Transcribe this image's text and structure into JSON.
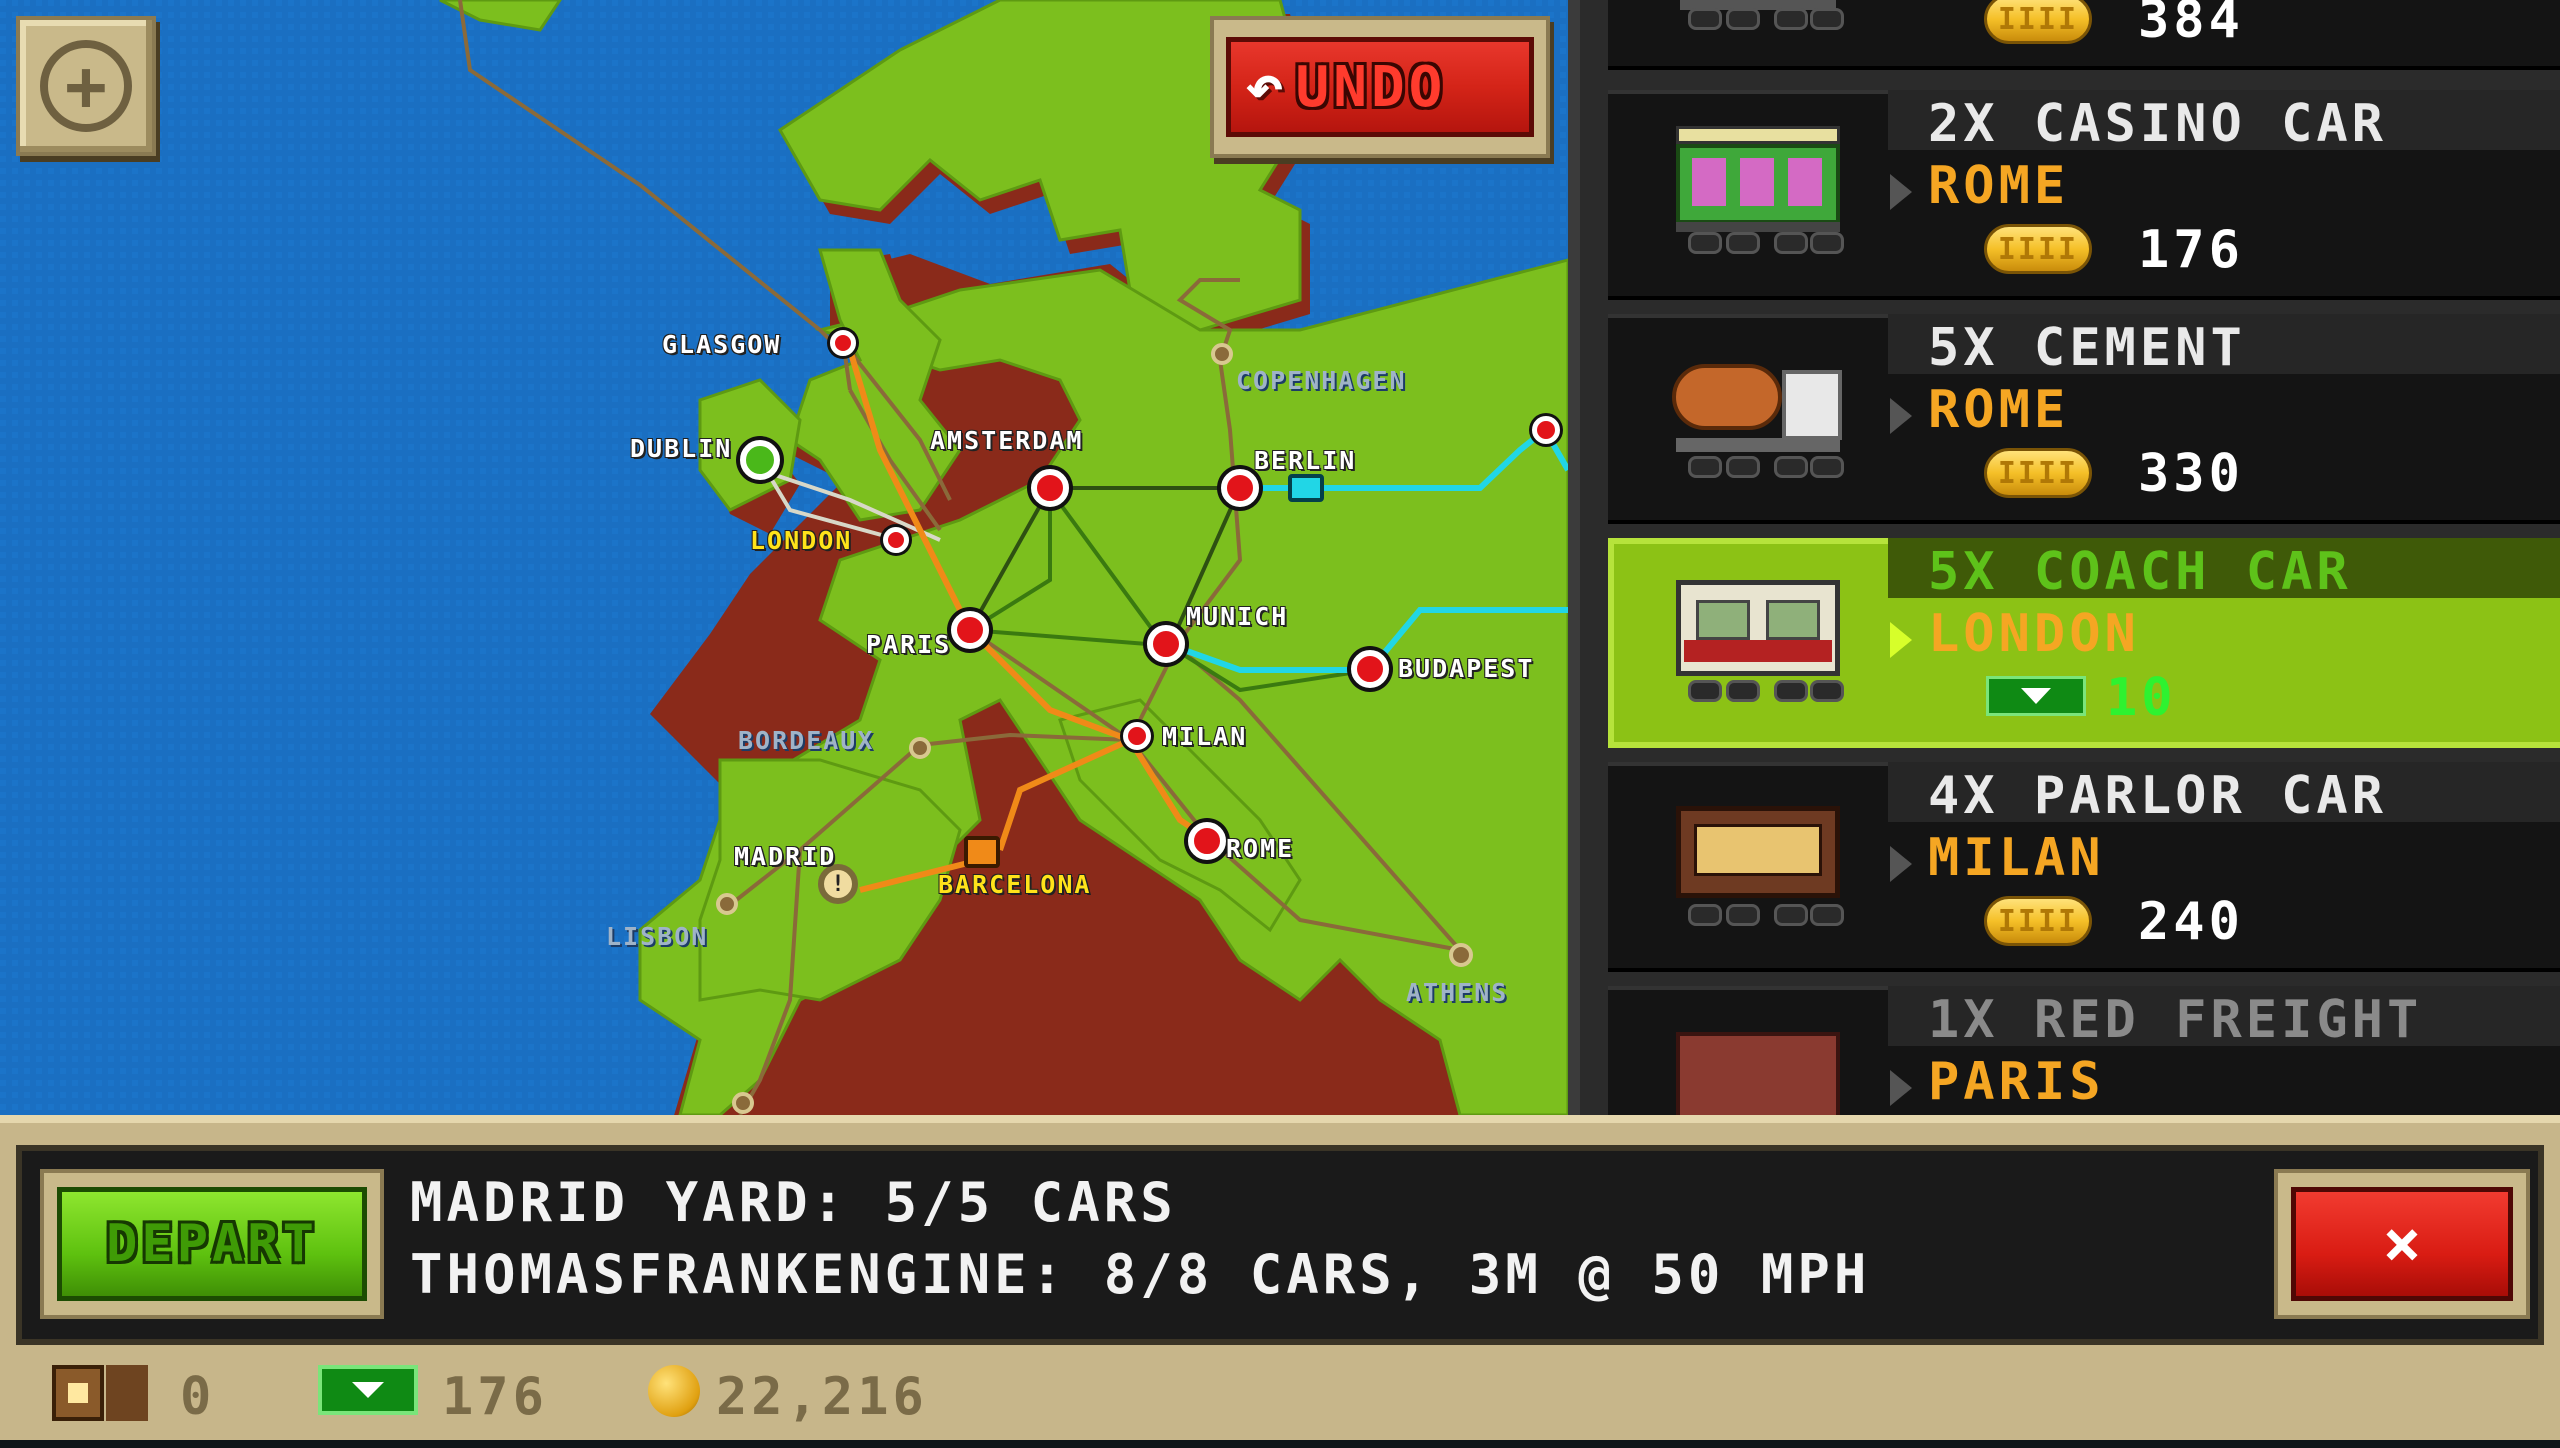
{
  "map": {
    "add_icon": "plus-icon",
    "undo_label": "UNDO",
    "undo_icon": "undo-arrow-icon",
    "cities": [
      {
        "name": "GLASGOW",
        "style": "white"
      },
      {
        "name": "DUBLIN",
        "style": "white"
      },
      {
        "name": "AMSTERDAM",
        "style": "white"
      },
      {
        "name": "COPENHAGEN",
        "style": "dim"
      },
      {
        "name": "BERLIN",
        "style": "white"
      },
      {
        "name": "LONDON",
        "style": "yellow"
      },
      {
        "name": "PARIS",
        "style": "white"
      },
      {
        "name": "MUNICH",
        "style": "white"
      },
      {
        "name": "BUDAPEST",
        "style": "white"
      },
      {
        "name": "BORDEAUX",
        "style": "dim"
      },
      {
        "name": "MILAN",
        "style": "white"
      },
      {
        "name": "MADRID",
        "style": "white"
      },
      {
        "name": "ROME",
        "style": "white"
      },
      {
        "name": "BARCELONA",
        "style": "yellow"
      },
      {
        "name": "LISBON",
        "style": "dim"
      },
      {
        "name": "ATHENS",
        "style": "dim"
      }
    ]
  },
  "cargo_list": {
    "items": [
      {
        "title": "",
        "city": "",
        "value": "384",
        "currency": "coin"
      },
      {
        "title": "2X CASINO CAR",
        "city": "ROME",
        "value": "176",
        "currency": "coin"
      },
      {
        "title": "5X CEMENT",
        "city": "ROME",
        "value": "330",
        "currency": "coin"
      },
      {
        "title": "5X COACH CAR",
        "city": "LONDON",
        "value": "10",
        "currency": "cash",
        "selected": true
      },
      {
        "title": "4X PARLOR CAR",
        "city": "MILAN",
        "value": "240",
        "currency": "coin"
      },
      {
        "title": "1X RED FREIGHT",
        "city": "PARIS",
        "value": "",
        "currency": "coin"
      }
    ]
  },
  "bottom": {
    "depart_label": "DEPART",
    "line1": "MADRID YARD: 5/5 CARS",
    "line2": "THOMASFRANKENGINE: 8/8 CARS, 3M @ 50 MPH",
    "close_icon": "close-x-icon",
    "close_label": "×"
  },
  "status": {
    "cars": "0",
    "cash": "176",
    "coins": "22,216"
  },
  "colors": {
    "ocean": "#1a6fc2",
    "land": "#7cbf1e",
    "selected": "#8cc215",
    "accent_orange": "#f5a623"
  }
}
